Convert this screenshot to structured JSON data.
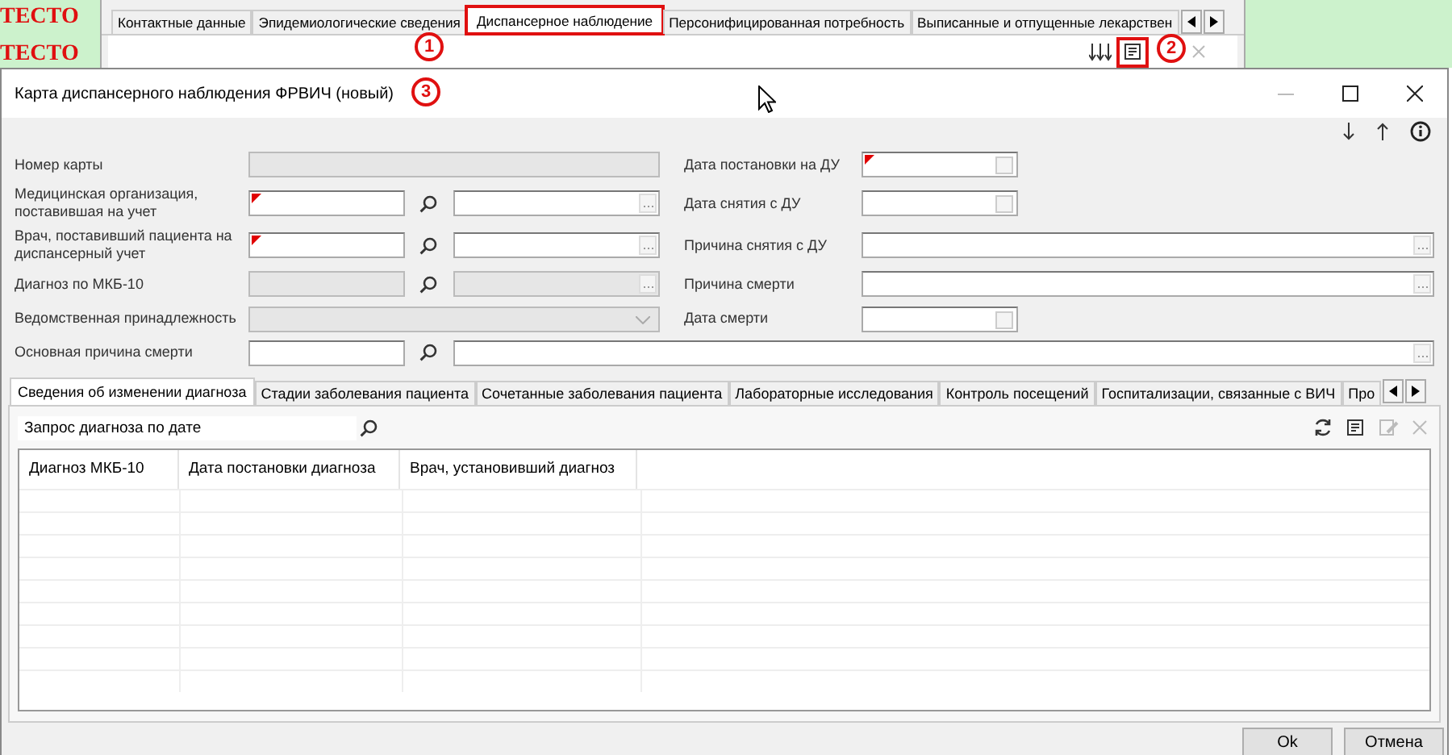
{
  "background": {
    "marks": [
      "ТЕСТО",
      "ТЕСТО"
    ],
    "tabs": [
      {
        "label": "Контактные данные",
        "selected": false,
        "highlighted": false
      },
      {
        "label": "Эпидемиологические сведения",
        "selected": false,
        "highlighted": false
      },
      {
        "label": "Диспансерное наблюдение",
        "selected": true,
        "highlighted": true
      },
      {
        "label": "Персонифицированная потребность",
        "selected": false,
        "highlighted": false
      },
      {
        "label": "Выписанные и отпущенные лекарствен",
        "selected": false,
        "highlighted": false
      }
    ],
    "toolbar": [
      {
        "kind": "sort",
        "disabled": false,
        "highlighted": false
      },
      {
        "kind": "document",
        "disabled": false,
        "highlighted": true
      },
      {
        "kind": "close",
        "disabled": true,
        "highlighted": false
      }
    ]
  },
  "callouts": [
    "1",
    "2",
    "3"
  ],
  "dialog": {
    "title": "Карта диспансерного наблюдения ФРВИЧ (новый)",
    "left_fields": [
      {
        "label": "Номер карты",
        "kind": "text",
        "required": false,
        "disabled": true
      },
      {
        "label": "Медицинская организация, поставившая на учет",
        "kind": "lookup",
        "required": true,
        "disabled": false
      },
      {
        "label": "Врач, поставивший пациента на диспансерный учет",
        "kind": "lookup",
        "required": true,
        "disabled": false
      },
      {
        "label": "Диагноз по МКБ-10",
        "kind": "lookup",
        "required": false,
        "disabled": true
      },
      {
        "label": "Ведомственная принадлежность",
        "kind": "combo",
        "required": false,
        "disabled": true
      },
      {
        "label": "Основная причина смерти",
        "kind": "lookup_wide",
        "required": false,
        "disabled": false
      }
    ],
    "right_fields": [
      {
        "label": "Дата постановки на ДУ",
        "kind": "date",
        "required": true,
        "disabled": false
      },
      {
        "label": "Дата снятия с ДУ",
        "kind": "date",
        "required": false,
        "disabled": false
      },
      {
        "label": "Причина снятия с ДУ",
        "kind": "picker",
        "required": false,
        "disabled": false
      },
      {
        "label": "Причина смерти",
        "kind": "picker",
        "required": false,
        "disabled": false
      },
      {
        "label": "Дата смерти",
        "kind": "date",
        "required": false,
        "disabled": false
      }
    ],
    "tabs": [
      {
        "label": "Сведения об изменении диагноза",
        "selected": true
      },
      {
        "label": "Стадии заболевания пациента",
        "selected": false
      },
      {
        "label": "Сочетанные заболевания пациента",
        "selected": false
      },
      {
        "label": "Лабораторные исследования",
        "selected": false
      },
      {
        "label": "Контроль посещений",
        "selected": false
      },
      {
        "label": "Госпитализации, связанные с ВИЧ",
        "selected": false
      },
      {
        "label": "Про",
        "selected": false
      }
    ],
    "query_label": "Запрос диагноза по дате",
    "grid_toolbar": [
      {
        "kind": "refresh",
        "disabled": false
      },
      {
        "kind": "document",
        "disabled": false
      },
      {
        "kind": "edit",
        "disabled": true
      },
      {
        "kind": "close",
        "disabled": true
      }
    ],
    "columns": [
      "Диагноз МКБ-10",
      "Дата постановки диагноза",
      "Врач, установивший диагноз"
    ],
    "buttons": [
      "Ok",
      "Отмена"
    ]
  }
}
